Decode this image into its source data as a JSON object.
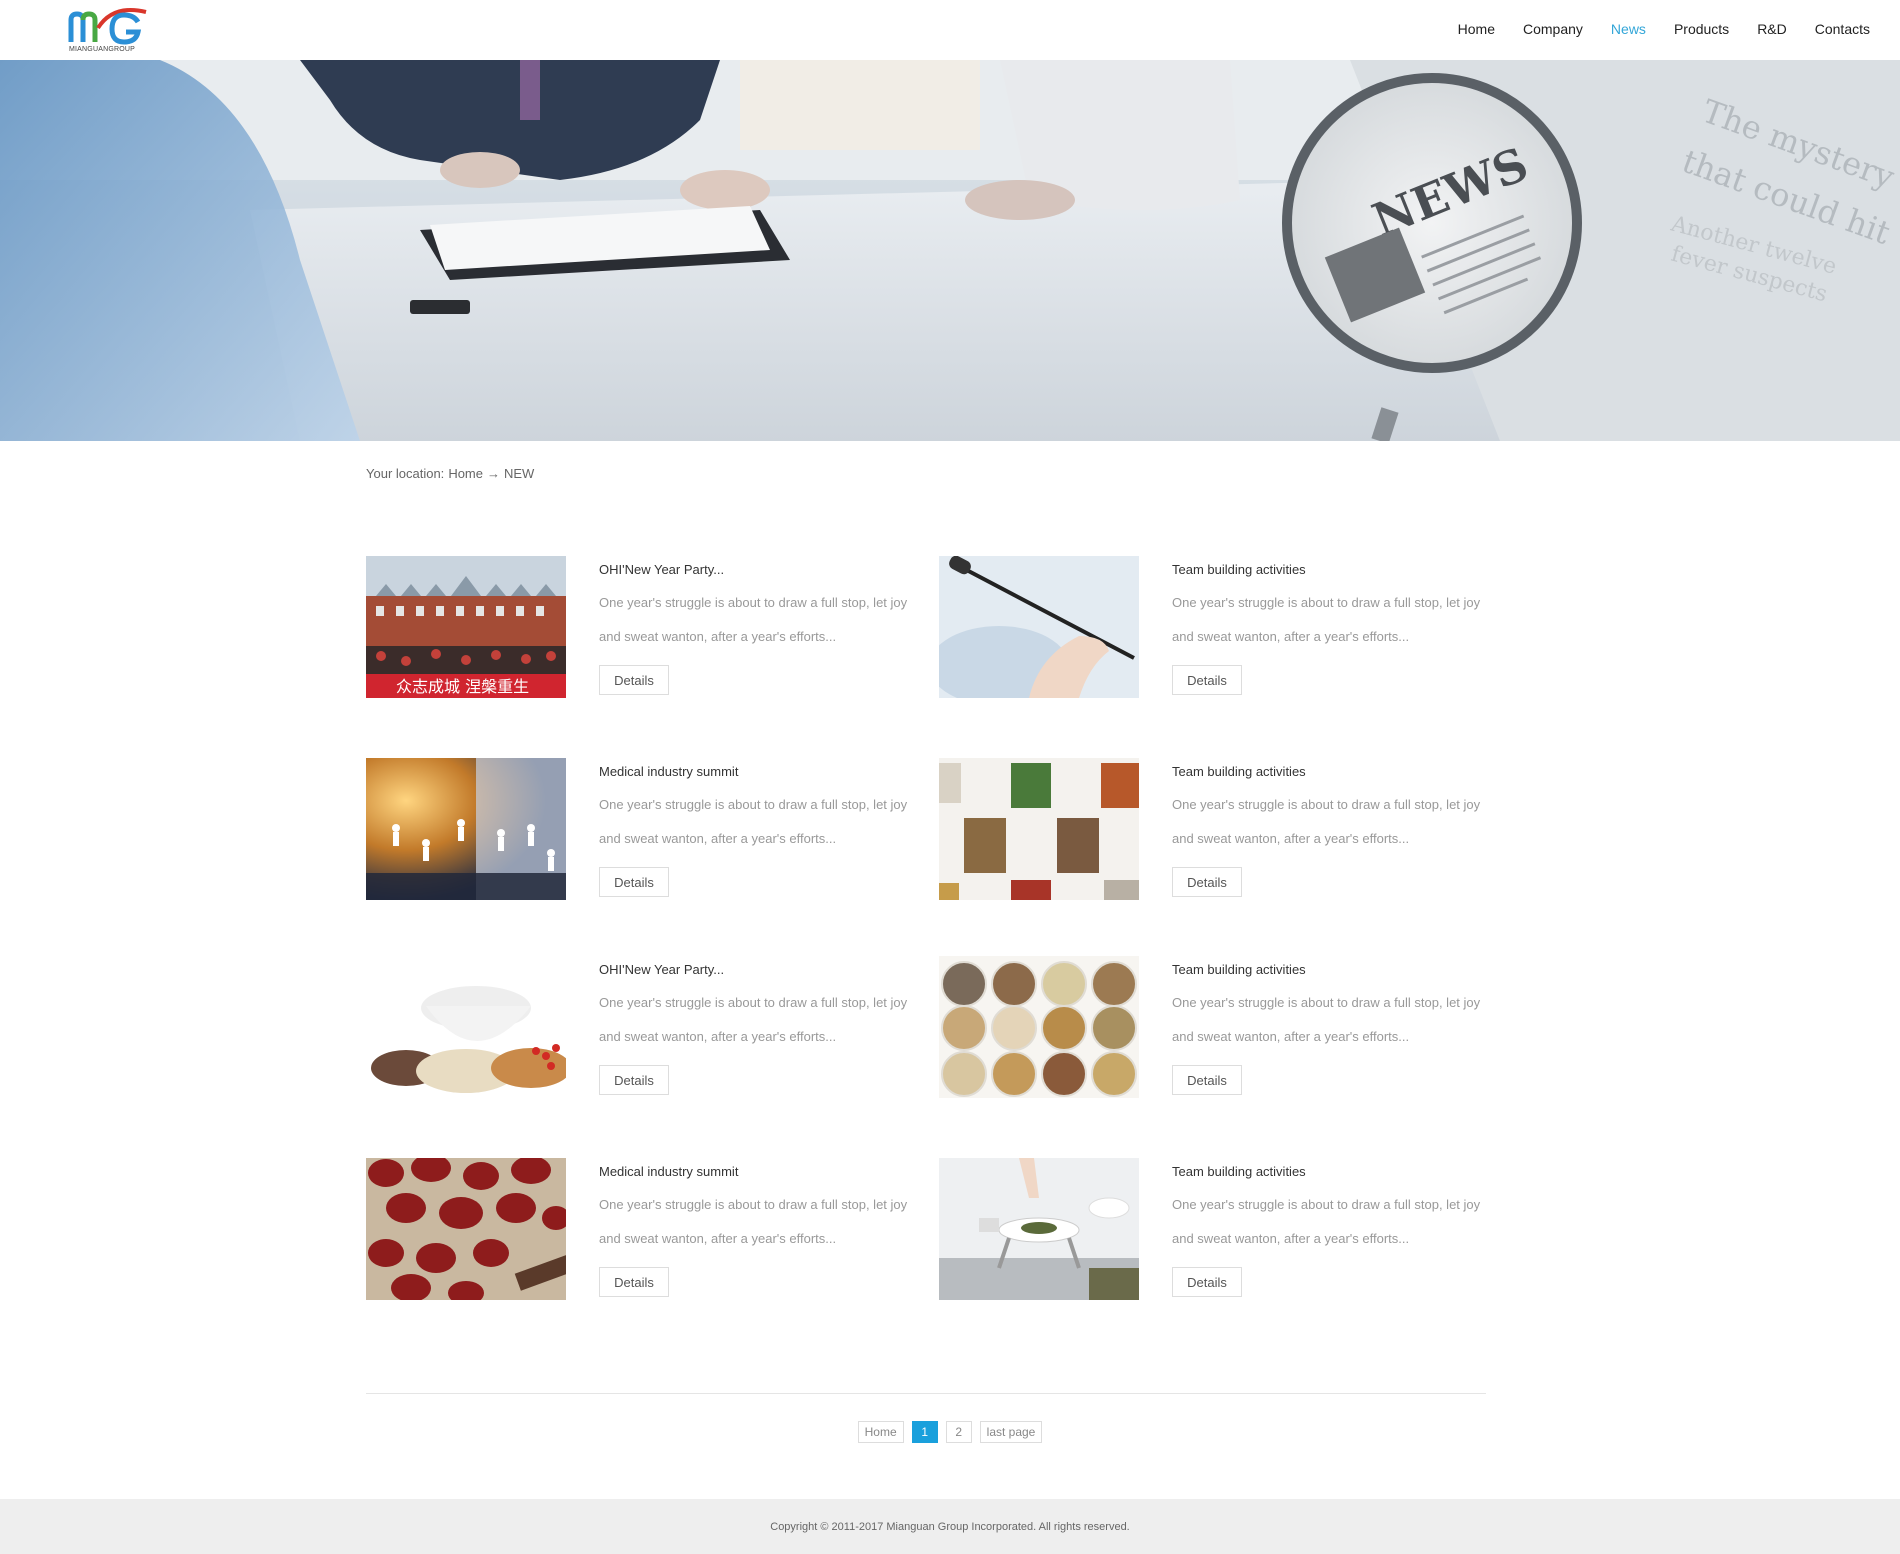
{
  "brand": {
    "logo_text": "MIANGUANGROUP",
    "colors": {
      "blue": "#2b8fd6",
      "red": "#d9362b",
      "green": "#48a843",
      "accent": "#33a6d8"
    }
  },
  "nav": {
    "items": [
      {
        "label": "Home"
      },
      {
        "label": "Company"
      },
      {
        "label": "News",
        "active": true
      },
      {
        "label": "Products"
      },
      {
        "label": "R&D"
      },
      {
        "label": "Contacts"
      }
    ]
  },
  "banner": {
    "magnifier_text": "NEWS",
    "paper_text_1": "The mystery",
    "paper_text_2": "that could hit",
    "paper_text_3": "Another twelve",
    "paper_text_4": "fever suspects"
  },
  "breadcrumb": {
    "prefix": "Your location:",
    "home": "Home",
    "arrow": "→",
    "current": "NEW"
  },
  "news": [
    {
      "title": "OHI'New Year Party...",
      "desc": "One year's struggle is about to draw a full stop, let joy and sweat wanton, after a year's efforts...",
      "button": "Details",
      "thumb": "crowd-photo",
      "banner_text": "众志成城  涅槃重生"
    },
    {
      "title": "Team building activities",
      "desc": "One year's struggle is about to draw a full stop, let joy and sweat wanton, after a year's efforts...",
      "button": "Details",
      "thumb": "microphone-photo"
    },
    {
      "title": "Medical industry summit",
      "desc": "One year's struggle is about to draw a full stop, let joy and sweat wanton, after a year's efforts...",
      "button": "Details",
      "thumb": "business-network-photo"
    },
    {
      "title": "Team building activities",
      "desc": "One year's struggle is about to draw a full stop, let joy and sweat wanton, after a year's efforts...",
      "button": "Details",
      "thumb": "herb-boxes-photo"
    },
    {
      "title": "OHI'New Year Party...",
      "desc": "One year's struggle is about to draw a full stop, let joy and sweat wanton, after a year's efforts...",
      "button": "Details",
      "thumb": "mortar-herbs-photo"
    },
    {
      "title": "Team building activities",
      "desc": "One year's struggle is about to draw a full stop, let joy and sweat wanton, after a year's efforts...",
      "button": "Details",
      "thumb": "herb-bowls-photo"
    },
    {
      "title": "Medical industry summit",
      "desc": "One year's struggle is about to draw a full stop, let joy and sweat wanton, after a year's efforts...",
      "button": "Details",
      "thumb": "red-dates-photo"
    },
    {
      "title": "Team building activities",
      "desc": "One year's struggle is about to draw a full stop, let joy and sweat wanton, after a year's efforts...",
      "button": "Details",
      "thumb": "tea-scale-photo"
    }
  ],
  "pager": {
    "first": "Home",
    "pages": [
      "1",
      "2"
    ],
    "current": "1",
    "last": "last page"
  },
  "footer": {
    "copyright": "Copyright © 2011-2017 Mianguan Group Incorporated. All rights reserved."
  }
}
